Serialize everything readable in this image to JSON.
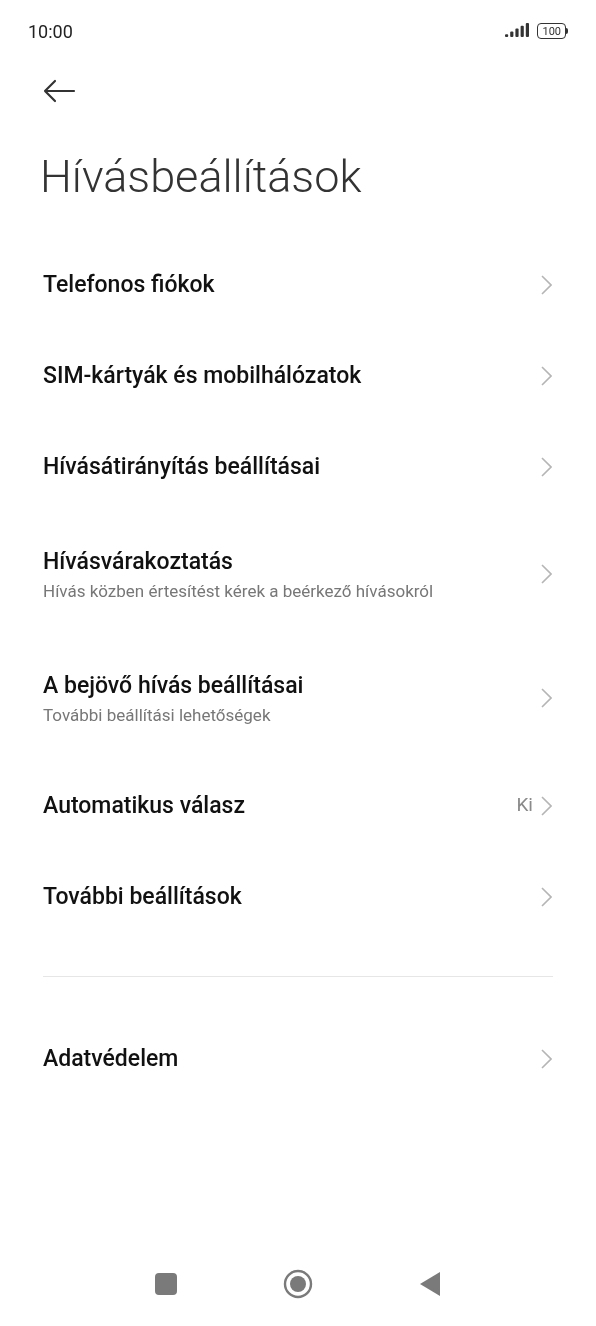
{
  "status_bar": {
    "time": "10:00",
    "battery": "100"
  },
  "title": "Hívásbeállítások",
  "sections": [
    {
      "items": [
        {
          "label": "Telefonos fiókok"
        },
        {
          "label": "SIM-kártyák és mobilhálózatok"
        },
        {
          "label": "Hívásátirányítás beállításai"
        },
        {
          "label": "Hívásvárakoztatás",
          "subtitle": "Hívás közben értesítést kérek a beérkező hívásokról"
        },
        {
          "label": "A bejövő hívás beállításai",
          "subtitle": "További beállítási lehetőségek"
        },
        {
          "label": "Automatikus válasz",
          "value": "Ki"
        },
        {
          "label": "További beállítások"
        }
      ]
    },
    {
      "items": [
        {
          "label": "Adatvédelem"
        }
      ]
    }
  ]
}
